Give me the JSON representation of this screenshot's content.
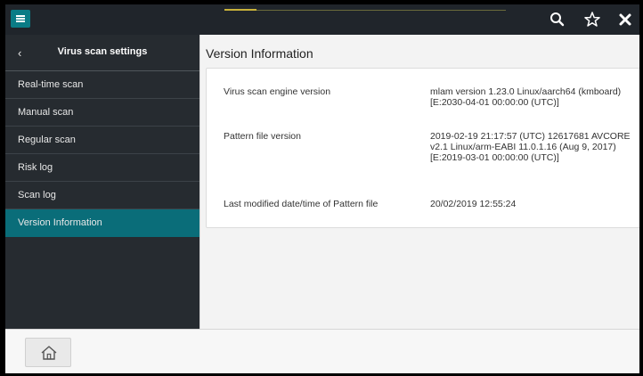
{
  "topbar": {
    "menu_icon": "hamburger-menu-icon",
    "icons": [
      "search-icon",
      "star-icon",
      "close-icon"
    ],
    "colors": {
      "background": "#20252b",
      "accent": "#0a7c86"
    }
  },
  "sidebar": {
    "back_glyph": "‹",
    "title": "Virus scan settings",
    "items": [
      {
        "label": "Real-time scan",
        "selected": false
      },
      {
        "label": "Manual scan",
        "selected": false
      },
      {
        "label": "Regular scan",
        "selected": false
      },
      {
        "label": "Risk log",
        "selected": false
      },
      {
        "label": "Scan log",
        "selected": false
      },
      {
        "label": "Version Information",
        "selected": true
      }
    ]
  },
  "main": {
    "title": "Version Information",
    "rows": [
      {
        "label": "Virus scan engine version",
        "value": "mlam version 1.23.0 Linux/aarch64 (kmboard)[E:2030-04-01 00:00:00 (UTC)]"
      },
      {
        "label": "Pattern file version",
        "value": "2019-02-19 21:17:57 (UTC) 12617681 AVCORE v2.1 Linux/arm-EABI 11.0.1.16 (Aug 9, 2017) [E:2019-03-01 00:00:00 (UTC)]"
      },
      {
        "label": "Last modified date/time of Pattern file",
        "value": "20/02/2019 12:55:24"
      }
    ]
  },
  "bottombar": {
    "home_icon": "home-icon"
  }
}
